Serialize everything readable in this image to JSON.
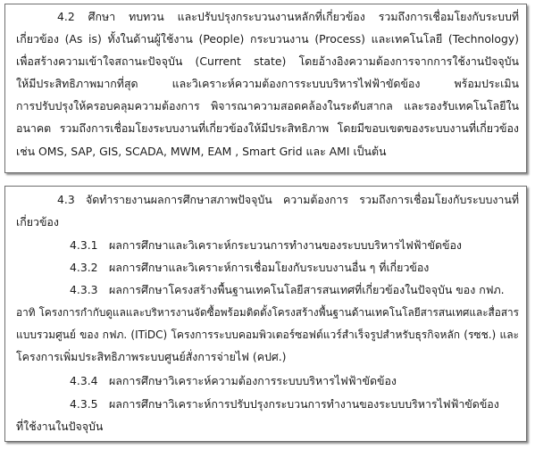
{
  "section_4_2": {
    "lines": [
      "4.2  ศึกษา ทบทวน และปรับปรุงกระบวนงานหลักที่เกี่ยวข้อง รวมถึงการเชื่อมโยงกับระบบที่",
      "เกี่ยวข้อง (As is) ทั้งในด้านผู้ใช้งาน (People) กระบวนงาน (Process) และเทคโนโลยี (Technology)",
      "เพื่อสร้างความเข้าใจสถานะปัจจุบัน (Current state) โดยอ้างอิงความต้องการจากการใช้งานปัจจุบัน",
      "ให้มีประสิทธิภาพมากที่สุด และวิเคราะห์ความต้องการระบบบริหารไฟฟ้าขัดข้อง พร้อมประเมิน",
      "การปรับปรุงให้ครอบคลุมความต้องการ พิจารณาความสอดคล้องในระดับสากล และรองรับเทคโนโลยีใน",
      "อนาคต รวมถึงการเชื่อมโยงระบบงานที่เกี่ยวข้องให้มีประสิทธิภาพ โดยมีขอบเขตของระบบงานที่เกี่ยวข้อง",
      "เช่น OMS, SAP, GIS, SCADA, MWM, EAM , Smart Grid และ AMI เป็นต้น"
    ]
  },
  "section_4_3": {
    "heading_lines": [
      "4.3  จัดทำรายงานผลการศึกษาสภาพปัจจุบัน ความต้องการ รวมถึงการเชื่อมโยงกับระบบงานที่",
      "เกี่ยวข้อง"
    ],
    "items": [
      {
        "num": "4.3.1",
        "text": "ผลการศึกษาและวิเคราะห์กระบวนการทำงานของระบบบริหารไฟฟ้าขัดข้อง"
      },
      {
        "num": "4.3.2",
        "text": "ผลการศึกษาและวิเคราะห์การเชื่อมโยงกับระบบงานอื่น ๆ ที่เกี่ยวข้อง"
      },
      {
        "num": "4.3.3",
        "text": "ผลการศึกษาโครงสร้างพื้นฐานเทคโนโลยีสารสนเทศที่เกี่ยวข้องในปัจจุบัน ของ กฟภ."
      }
    ],
    "item_4_3_3_continuation": [
      "อาทิ โครงการกำกับดูแลและบริหารงานจัดซื้อพร้อมติดตั้งโครงสร้างพื้นฐานด้านเทคโนโลยีสารสนเทศและสื่อสาร",
      "แบบรวมศูนย์ ของ กฟภ. (ITiDC) โครงการระบบคอมพิวเตอร์ซอฟต์แวร์สำเร็จรูปสำหรับธุรกิจหลัก (รซช.) และ",
      "โครงการเพิ่มประสิทธิภาพระบบศูนย์สั่งการจ่ายไฟ (คปศ.)"
    ],
    "items_after": [
      {
        "num": "4.3.4",
        "text": "ผลการศึกษาวิเคราะห์ความต้องการระบบบริหารไฟฟ้าขัดข้อง"
      },
      {
        "num": "4.3.5",
        "text": "ผลการศึกษาวิเคราะห์การปรับปรุงกระบวนการทำงานของระบบบริหารไฟฟ้าขัดข้อง"
      }
    ],
    "item_4_3_5_continuation": "ที่ใช้งานในปัจจุบัน"
  }
}
